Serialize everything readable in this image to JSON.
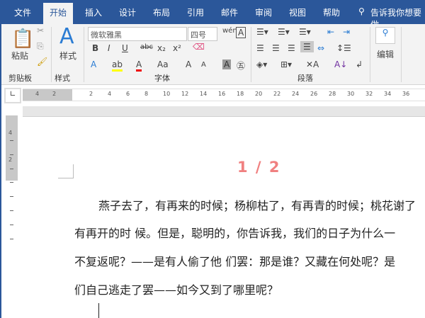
{
  "tabs": [
    "文件",
    "开始",
    "插入",
    "设计",
    "布局",
    "引用",
    "邮件",
    "审阅",
    "视图",
    "帮助"
  ],
  "tell_me": "告诉我你想要做",
  "ribbon": {
    "clipboard": {
      "paste": "粘贴",
      "label": "剪贴板"
    },
    "styles": {
      "button": "样式",
      "label": "样式"
    },
    "font": {
      "name": "微软雅黑",
      "size": "四号",
      "label": "字体",
      "bold": "B",
      "italic": "I",
      "underline": "U",
      "strike": "abc",
      "sub": "x₂",
      "sup": "x²",
      "case": "Aa",
      "grow": "A",
      "shrink": "A"
    },
    "paragraph": {
      "label": "段落"
    },
    "editing": {
      "button": "编辑"
    },
    "colors": {
      "highlight": "#ffff00",
      "font_color": "#e00000"
    }
  },
  "ruler": {
    "left": [
      "4",
      "2"
    ],
    "ticks": [
      "2",
      "4",
      "6",
      "8",
      "10",
      "12",
      "14",
      "16",
      "18",
      "20",
      "22",
      "24",
      "26",
      "28",
      "30",
      "32",
      "34",
      "36"
    ]
  },
  "vruler": [
    "4",
    "2"
  ],
  "document": {
    "page_heading": "1 / 2",
    "lines": [
      "燕子去了，有再来的时候；杨柳枯了，有再青的时候；桃花谢了",
      "有再开的时 候。但是，聪明的，你告诉我，我们的日子为什么一",
      "不复返呢？——是有人偷了他 们罢：那是谁？又藏在何处呢？是",
      "们自己逃走了罢——如今又到了哪里呢？"
    ]
  }
}
